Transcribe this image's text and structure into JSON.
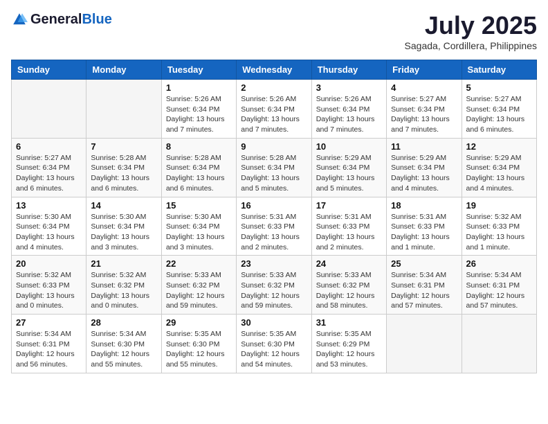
{
  "header": {
    "logo_general": "General",
    "logo_blue": "Blue",
    "title": "July 2025",
    "location": "Sagada, Cordillera, Philippines"
  },
  "weekdays": [
    "Sunday",
    "Monday",
    "Tuesday",
    "Wednesday",
    "Thursday",
    "Friday",
    "Saturday"
  ],
  "weeks": [
    [
      {
        "day": "",
        "info": ""
      },
      {
        "day": "",
        "info": ""
      },
      {
        "day": "1",
        "info": "Sunrise: 5:26 AM\nSunset: 6:34 PM\nDaylight: 13 hours and 7 minutes."
      },
      {
        "day": "2",
        "info": "Sunrise: 5:26 AM\nSunset: 6:34 PM\nDaylight: 13 hours and 7 minutes."
      },
      {
        "day": "3",
        "info": "Sunrise: 5:26 AM\nSunset: 6:34 PM\nDaylight: 13 hours and 7 minutes."
      },
      {
        "day": "4",
        "info": "Sunrise: 5:27 AM\nSunset: 6:34 PM\nDaylight: 13 hours and 7 minutes."
      },
      {
        "day": "5",
        "info": "Sunrise: 5:27 AM\nSunset: 6:34 PM\nDaylight: 13 hours and 6 minutes."
      }
    ],
    [
      {
        "day": "6",
        "info": "Sunrise: 5:27 AM\nSunset: 6:34 PM\nDaylight: 13 hours and 6 minutes."
      },
      {
        "day": "7",
        "info": "Sunrise: 5:28 AM\nSunset: 6:34 PM\nDaylight: 13 hours and 6 minutes."
      },
      {
        "day": "8",
        "info": "Sunrise: 5:28 AM\nSunset: 6:34 PM\nDaylight: 13 hours and 6 minutes."
      },
      {
        "day": "9",
        "info": "Sunrise: 5:28 AM\nSunset: 6:34 PM\nDaylight: 13 hours and 5 minutes."
      },
      {
        "day": "10",
        "info": "Sunrise: 5:29 AM\nSunset: 6:34 PM\nDaylight: 13 hours and 5 minutes."
      },
      {
        "day": "11",
        "info": "Sunrise: 5:29 AM\nSunset: 6:34 PM\nDaylight: 13 hours and 4 minutes."
      },
      {
        "day": "12",
        "info": "Sunrise: 5:29 AM\nSunset: 6:34 PM\nDaylight: 13 hours and 4 minutes."
      }
    ],
    [
      {
        "day": "13",
        "info": "Sunrise: 5:30 AM\nSunset: 6:34 PM\nDaylight: 13 hours and 4 minutes."
      },
      {
        "day": "14",
        "info": "Sunrise: 5:30 AM\nSunset: 6:34 PM\nDaylight: 13 hours and 3 minutes."
      },
      {
        "day": "15",
        "info": "Sunrise: 5:30 AM\nSunset: 6:34 PM\nDaylight: 13 hours and 3 minutes."
      },
      {
        "day": "16",
        "info": "Sunrise: 5:31 AM\nSunset: 6:33 PM\nDaylight: 13 hours and 2 minutes."
      },
      {
        "day": "17",
        "info": "Sunrise: 5:31 AM\nSunset: 6:33 PM\nDaylight: 13 hours and 2 minutes."
      },
      {
        "day": "18",
        "info": "Sunrise: 5:31 AM\nSunset: 6:33 PM\nDaylight: 13 hours and 1 minute."
      },
      {
        "day": "19",
        "info": "Sunrise: 5:32 AM\nSunset: 6:33 PM\nDaylight: 13 hours and 1 minute."
      }
    ],
    [
      {
        "day": "20",
        "info": "Sunrise: 5:32 AM\nSunset: 6:33 PM\nDaylight: 13 hours and 0 minutes."
      },
      {
        "day": "21",
        "info": "Sunrise: 5:32 AM\nSunset: 6:32 PM\nDaylight: 13 hours and 0 minutes."
      },
      {
        "day": "22",
        "info": "Sunrise: 5:33 AM\nSunset: 6:32 PM\nDaylight: 12 hours and 59 minutes."
      },
      {
        "day": "23",
        "info": "Sunrise: 5:33 AM\nSunset: 6:32 PM\nDaylight: 12 hours and 59 minutes."
      },
      {
        "day": "24",
        "info": "Sunrise: 5:33 AM\nSunset: 6:32 PM\nDaylight: 12 hours and 58 minutes."
      },
      {
        "day": "25",
        "info": "Sunrise: 5:34 AM\nSunset: 6:31 PM\nDaylight: 12 hours and 57 minutes."
      },
      {
        "day": "26",
        "info": "Sunrise: 5:34 AM\nSunset: 6:31 PM\nDaylight: 12 hours and 57 minutes."
      }
    ],
    [
      {
        "day": "27",
        "info": "Sunrise: 5:34 AM\nSunset: 6:31 PM\nDaylight: 12 hours and 56 minutes."
      },
      {
        "day": "28",
        "info": "Sunrise: 5:34 AM\nSunset: 6:30 PM\nDaylight: 12 hours and 55 minutes."
      },
      {
        "day": "29",
        "info": "Sunrise: 5:35 AM\nSunset: 6:30 PM\nDaylight: 12 hours and 55 minutes."
      },
      {
        "day": "30",
        "info": "Sunrise: 5:35 AM\nSunset: 6:30 PM\nDaylight: 12 hours and 54 minutes."
      },
      {
        "day": "31",
        "info": "Sunrise: 5:35 AM\nSunset: 6:29 PM\nDaylight: 12 hours and 53 minutes."
      },
      {
        "day": "",
        "info": ""
      },
      {
        "day": "",
        "info": ""
      }
    ]
  ]
}
